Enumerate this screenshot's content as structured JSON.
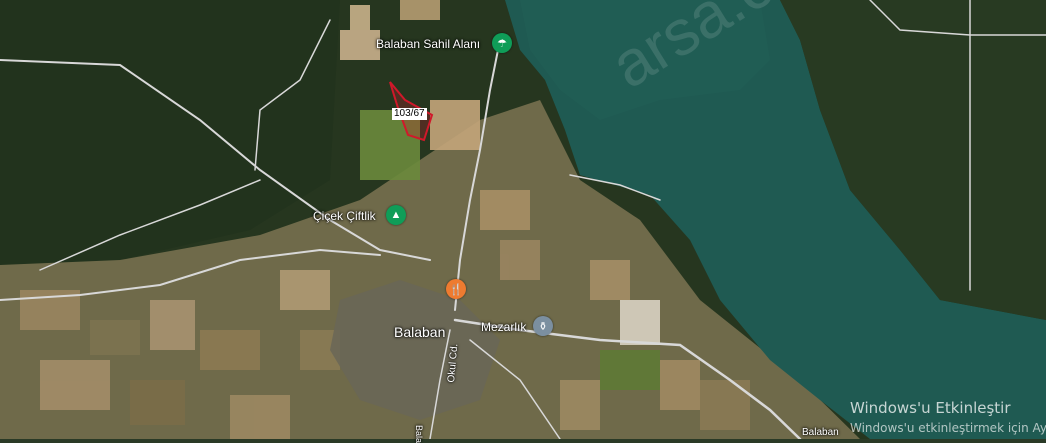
{
  "places": {
    "beach": {
      "label": "Balaban Sahil Alanı",
      "icon": "beach-umbrella-icon",
      "color": "#0f9d58"
    },
    "camp": {
      "label": "Çiçek Çiftlik",
      "icon": "campground-icon",
      "color": "#0f9d58"
    },
    "restaurant": {
      "icon": "fork-knife-icon",
      "color": "#ee7b30"
    },
    "town": {
      "label": "Balaban"
    },
    "cemetery": {
      "label": "Mezarlık",
      "icon": "cemetery-icon",
      "color": "#7b8fa0"
    },
    "street1": {
      "label": "Okul Cd."
    },
    "street2": {
      "label": "Balaban"
    },
    "street3": {
      "label": "Bala"
    }
  },
  "parcel": {
    "label": "103/67",
    "color": "#d0182a"
  },
  "watermark": {
    "text": "arsa.com"
  },
  "windows_notice": {
    "title": "Windows'u Etkinleştir",
    "subtitle": "Windows'u etkinleştirmek için Ay"
  },
  "colors": {
    "water": "#1f5a52",
    "forest": "#25351f",
    "field": "#8a7a55",
    "road": "#d9d9d9"
  }
}
